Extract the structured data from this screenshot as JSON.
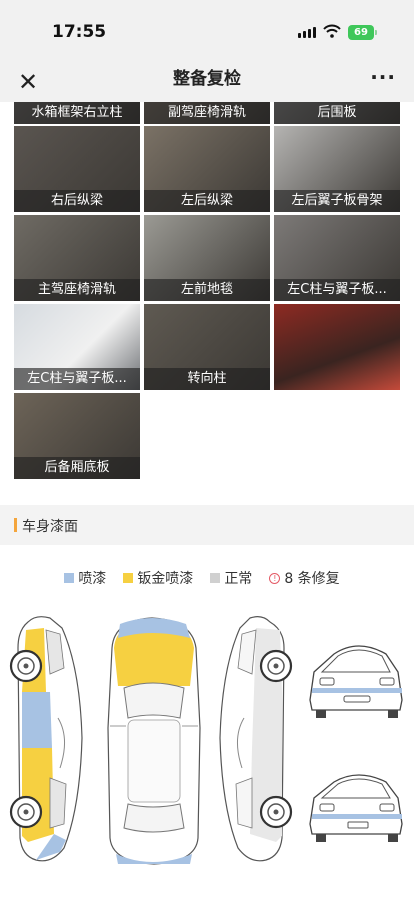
{
  "status_bar": {
    "time": "17:55",
    "battery": "69"
  },
  "nav": {
    "close_icon": "close-icon",
    "title": "整备复检",
    "more_icon": "more-icon"
  },
  "photo_grid": {
    "captions": [
      "水箱框架右立柱",
      "副驾座椅滑轨",
      "后围板",
      "右后纵梁",
      "左后纵梁",
      "左后翼子板骨架",
      "主驾座椅滑轨",
      "左前地毯",
      "左C柱与翼子板...",
      "左C柱与翼子板...",
      "转向柱",
      "",
      "后备厢底板"
    ]
  },
  "paint_section": {
    "title": "车身漆面",
    "legend": [
      {
        "label": "喷漆",
        "color": "#a7c2e3"
      },
      {
        "label": "钣金喷漆",
        "color": "#f6d041"
      },
      {
        "label": "正常",
        "color": "#d0d0d0"
      }
    ],
    "repair_count": "8 条修复",
    "repair_icon": "alert-icon"
  }
}
